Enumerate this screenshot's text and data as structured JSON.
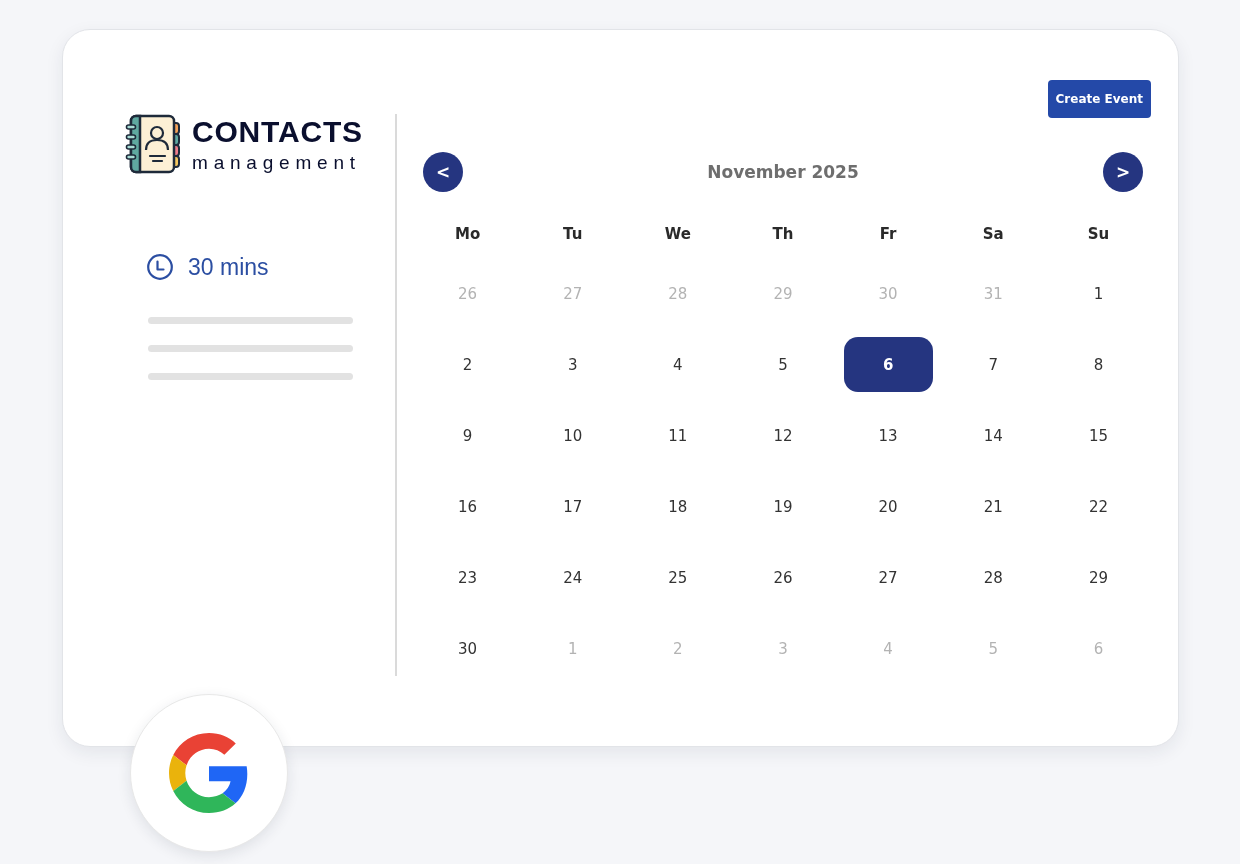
{
  "brand": {
    "title": "CONTACTS",
    "subtitle": "management"
  },
  "create_event_button": {
    "label": "Create Event"
  },
  "event": {
    "duration": "30 mins"
  },
  "calendar": {
    "prev_button": "<",
    "month_title": "November 2025",
    "next_button": ">",
    "weekdays": [
      "Mo",
      "Tu",
      "We",
      "Th",
      "Fr",
      "Sa",
      "Su"
    ],
    "weeks": [
      [
        {
          "day": "26",
          "in_month": false,
          "selected": false
        },
        {
          "day": "27",
          "in_month": false,
          "selected": false
        },
        {
          "day": "28",
          "in_month": false,
          "selected": false
        },
        {
          "day": "29",
          "in_month": false,
          "selected": false
        },
        {
          "day": "30",
          "in_month": false,
          "selected": false
        },
        {
          "day": "31",
          "in_month": false,
          "selected": false
        },
        {
          "day": "1",
          "in_month": true,
          "selected": false
        }
      ],
      [
        {
          "day": "2",
          "in_month": true,
          "selected": false
        },
        {
          "day": "3",
          "in_month": true,
          "selected": false
        },
        {
          "day": "4",
          "in_month": true,
          "selected": false
        },
        {
          "day": "5",
          "in_month": true,
          "selected": false
        },
        {
          "day": "6",
          "in_month": true,
          "selected": true
        },
        {
          "day": "7",
          "in_month": true,
          "selected": false
        },
        {
          "day": "8",
          "in_month": true,
          "selected": false
        }
      ],
      [
        {
          "day": "9",
          "in_month": true,
          "selected": false
        },
        {
          "day": "10",
          "in_month": true,
          "selected": false
        },
        {
          "day": "11",
          "in_month": true,
          "selected": false
        },
        {
          "day": "12",
          "in_month": true,
          "selected": false
        },
        {
          "day": "13",
          "in_month": true,
          "selected": false
        },
        {
          "day": "14",
          "in_month": true,
          "selected": false
        },
        {
          "day": "15",
          "in_month": true,
          "selected": false
        }
      ],
      [
        {
          "day": "16",
          "in_month": true,
          "selected": false
        },
        {
          "day": "17",
          "in_month": true,
          "selected": false
        },
        {
          "day": "18",
          "in_month": true,
          "selected": false
        },
        {
          "day": "19",
          "in_month": true,
          "selected": false
        },
        {
          "day": "20",
          "in_month": true,
          "selected": false
        },
        {
          "day": "21",
          "in_month": true,
          "selected": false
        },
        {
          "day": "22",
          "in_month": true,
          "selected": false
        }
      ],
      [
        {
          "day": "23",
          "in_month": true,
          "selected": false
        },
        {
          "day": "24",
          "in_month": true,
          "selected": false
        },
        {
          "day": "25",
          "in_month": true,
          "selected": false
        },
        {
          "day": "26",
          "in_month": true,
          "selected": false
        },
        {
          "day": "27",
          "in_month": true,
          "selected": false
        },
        {
          "day": "28",
          "in_month": true,
          "selected": false
        },
        {
          "day": "29",
          "in_month": true,
          "selected": false
        }
      ],
      [
        {
          "day": "30",
          "in_month": true,
          "selected": false
        },
        {
          "day": "1",
          "in_month": false,
          "selected": false
        },
        {
          "day": "2",
          "in_month": false,
          "selected": false
        },
        {
          "day": "3",
          "in_month": false,
          "selected": false
        },
        {
          "day": "4",
          "in_month": false,
          "selected": false
        },
        {
          "day": "5",
          "in_month": false,
          "selected": false
        },
        {
          "day": "6",
          "in_month": false,
          "selected": false
        }
      ]
    ]
  }
}
